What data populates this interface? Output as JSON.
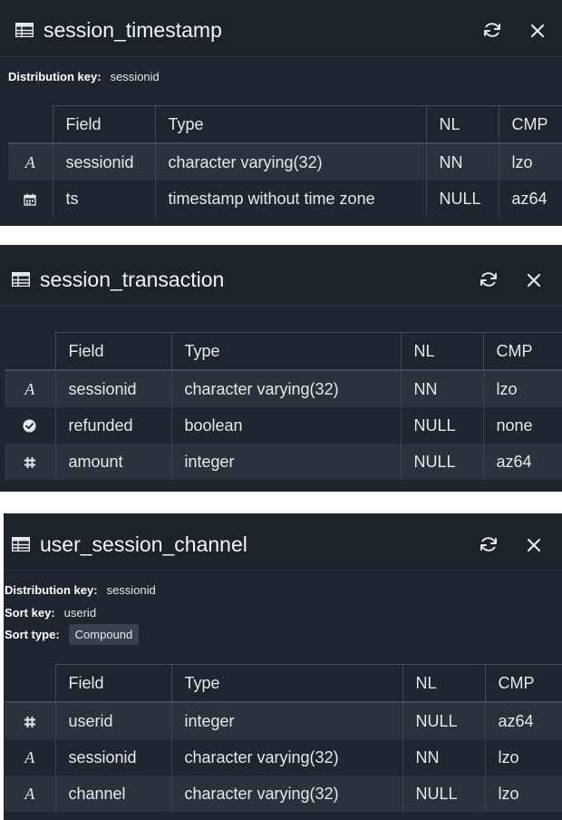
{
  "panels": [
    {
      "title": "session_timestamp",
      "distribution_key_label": "Distribution key:",
      "distribution_key": "sessionid",
      "columns": [
        "Field",
        "Type",
        "NL",
        "CMP"
      ],
      "rows": [
        {
          "icon": "text-type-icon",
          "glyph": "A",
          "field": "sessionid",
          "type": "character varying(32)",
          "nl": "NN",
          "cmp": "lzo"
        },
        {
          "icon": "calendar-icon",
          "glyph": "",
          "field": "ts",
          "type": "timestamp without time zone",
          "nl": "NULL",
          "cmp": "az64"
        }
      ]
    },
    {
      "title": "session_transaction",
      "columns": [
        "Field",
        "Type",
        "NL",
        "CMP"
      ],
      "rows": [
        {
          "icon": "text-type-icon",
          "glyph": "A",
          "field": "sessionid",
          "type": "character varying(32)",
          "nl": "NN",
          "cmp": "lzo"
        },
        {
          "icon": "check-circle-icon",
          "glyph": "",
          "field": "refunded",
          "type": "boolean",
          "nl": "NULL",
          "cmp": "none"
        },
        {
          "icon": "hash-icon",
          "glyph": "#",
          "field": "amount",
          "type": "integer",
          "nl": "NULL",
          "cmp": "az64"
        }
      ]
    },
    {
      "title": "user_session_channel",
      "distribution_key_label": "Distribution key:",
      "distribution_key": "sessionid",
      "sort_key_label": "Sort key:",
      "sort_key": "userid",
      "sort_type_label": "Sort type:",
      "sort_type": "Compound",
      "columns": [
        "Field",
        "Type",
        "NL",
        "CMP"
      ],
      "rows": [
        {
          "icon": "hash-icon",
          "glyph": "#",
          "field": "userid",
          "type": "integer",
          "nl": "NULL",
          "cmp": "az64"
        },
        {
          "icon": "text-type-icon",
          "glyph": "A",
          "field": "sessionid",
          "type": "character varying(32)",
          "nl": "NN",
          "cmp": "lzo"
        },
        {
          "icon": "text-type-icon",
          "glyph": "A",
          "field": "channel",
          "type": "character varying(32)",
          "nl": "NULL",
          "cmp": "lzo"
        }
      ]
    }
  ]
}
